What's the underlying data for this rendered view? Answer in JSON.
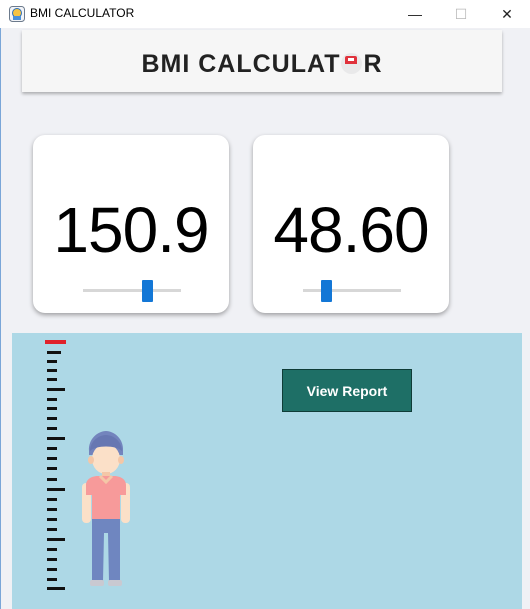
{
  "window": {
    "title": "BMI CALCULATOR",
    "minimize_glyph": "—",
    "maximize_glyph": "☐",
    "close_glyph": "✕"
  },
  "header": {
    "title_before": "BMI CALCULAT",
    "title_after": "R",
    "title_o_icon": "scale-o-icon"
  },
  "height_card": {
    "value": "150.9",
    "slider_level": 0.66
  },
  "weight_card": {
    "value": "48.60",
    "slider_level": 0.25
  },
  "scene": {
    "background": "#add8e6",
    "report_button_label": "View Report",
    "report_button_color": "#1e6f66",
    "scale_marker_color": "#e0222b",
    "slider_color": "#1377d6"
  }
}
